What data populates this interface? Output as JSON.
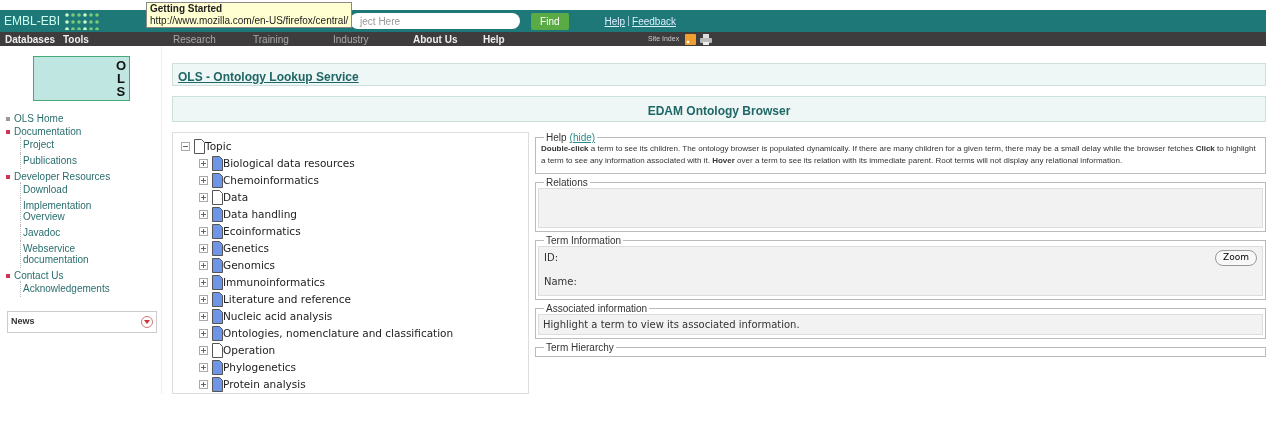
{
  "header": {
    "logo": "EMBL-EBI",
    "search": {
      "placeholder": "ject Here"
    },
    "find_button": "Find",
    "links": [
      "Help",
      "Feedback"
    ]
  },
  "tooltip": {
    "title": "Getting Started",
    "url": "http://www.mozilla.com/en-US/firefox/central/"
  },
  "nav": {
    "items": [
      "Databases",
      "Tools",
      "Research",
      "Training",
      "Industry",
      "About Us",
      "Help"
    ],
    "site_index": "Site Index"
  },
  "sidebar": {
    "logo_letters": [
      "O",
      "L",
      "S"
    ],
    "items": [
      {
        "label": "OLS Home",
        "color": "#999999"
      },
      {
        "label": "Documentation",
        "color": "#cc3355",
        "children": [
          {
            "label": "Project"
          },
          {
            "label": "Publications"
          }
        ]
      },
      {
        "label": "Developer Resources",
        "color": "#cc3355",
        "children": [
          {
            "label": "Download"
          },
          {
            "label": "Implementation Overview"
          },
          {
            "label": "Javadoc"
          },
          {
            "label": "Webservice documentation"
          }
        ]
      },
      {
        "label": "Contact Us",
        "color": "#cc3355",
        "children": [
          {
            "label": "Acknowledgements"
          }
        ]
      }
    ],
    "news": {
      "title": "News",
      "expanded": false
    }
  },
  "page_title": "OLS - Ontology Lookup Service",
  "browser_title": "EDAM Ontology Browser",
  "tree": {
    "label": "Topic",
    "expanded": true,
    "color": "#ffffff",
    "children": [
      {
        "label": "Biological data resources",
        "expanded": false,
        "color": "#6f95e8"
      },
      {
        "label": "Chemoinformatics",
        "expanded": false,
        "color": "#6f95e8"
      },
      {
        "label": "Data",
        "expanded": false,
        "color": "#ffffff"
      },
      {
        "label": "Data handling",
        "expanded": false,
        "color": "#6f95e8"
      },
      {
        "label": "Ecoinformatics",
        "expanded": false,
        "color": "#6f95e8"
      },
      {
        "label": "Genetics",
        "expanded": false,
        "color": "#6f95e8"
      },
      {
        "label": "Genomics",
        "expanded": false,
        "color": "#6f95e8"
      },
      {
        "label": "Immunoinformatics",
        "expanded": false,
        "color": "#6f95e8"
      },
      {
        "label": "Literature and reference",
        "expanded": false,
        "color": "#6f95e8"
      },
      {
        "label": "Nucleic acid analysis",
        "expanded": false,
        "color": "#6f95e8"
      },
      {
        "label": "Ontologies, nomenclature and classification",
        "expanded": false,
        "color": "#6f95e8"
      },
      {
        "label": "Operation",
        "expanded": false,
        "color": "#ffffff"
      },
      {
        "label": "Phylogenetics",
        "expanded": false,
        "color": "#6f95e8"
      },
      {
        "label": "Protein analysis",
        "expanded": false,
        "color": "#6f95e8"
      }
    ]
  },
  "help": {
    "legend": "Help",
    "hide_link": "(hide)",
    "text": "**Double-click** a term to see its children. The ontology browser is populated dynamically. If there are many children for a given term, there may be a small delay while the browser fetches **Click** to highlight a term to see any information associated with it. **Hover** over a term to see its relation with its immediate parent. Root terms will not display any relational information."
  },
  "relations": {
    "legend": "Relations"
  },
  "term_information": {
    "legend": "Term Information",
    "id_label": "ID:",
    "name_label": "Name:",
    "zoom_button": "Zoom"
  },
  "associated_information": {
    "legend": "Associated information",
    "text": "Highlight a term to view its associated information."
  },
  "term_hierarchy": {
    "legend": "Term Hierarchy"
  }
}
